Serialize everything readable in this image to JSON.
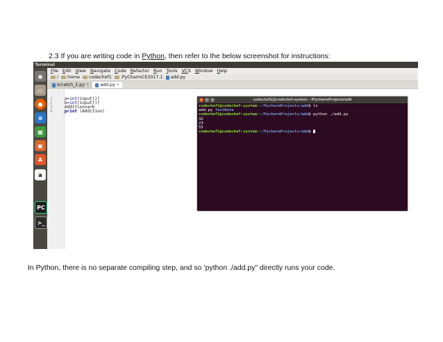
{
  "intro": {
    "prefix": "2.3 If you are writing code in ",
    "link": "Python",
    "suffix": ", then refer to the below screenshot for instructions:"
  },
  "outro": "In Python, there is no separate compiling step, and so ‘python ./add.py” directly runs your code.",
  "screenshot": {
    "topbar_title": "Terminal",
    "menu": [
      {
        "key": "F",
        "rest": "ile"
      },
      {
        "key": "E",
        "rest": "dit"
      },
      {
        "key": "V",
        "rest": "iew"
      },
      {
        "key": "N",
        "rest": "avigate"
      },
      {
        "key": "C",
        "rest": "ode"
      },
      {
        "key": "R",
        "rest": "efactor"
      },
      {
        "key": "R",
        "rest": "un"
      },
      {
        "key": "T",
        "rest": "ools"
      },
      {
        "key": "VC",
        "rest": "S"
      },
      {
        "key": "W",
        "rest": "indow"
      },
      {
        "key": "H",
        "rest": "elp"
      }
    ],
    "breadcrumbs": [
      "/",
      "home",
      "codechef1",
      ".PyCharmCE2017.1",
      "add.py"
    ],
    "tabs": [
      {
        "label": "scratch_1.py",
        "active": false
      },
      {
        "label": "add.py",
        "active": true
      }
    ],
    "editor": {
      "line_numbers": [
        "1",
        "2",
        "3",
        "4"
      ],
      "lines": [
        {
          "pre": "a=",
          "fn": "int",
          "post": "(input())"
        },
        {
          "pre": "b=",
          "fn": "int",
          "post": "(input())"
        },
        {
          "pre": "Addition=a+b",
          "fn": "",
          "post": ""
        },
        {
          "pre": "",
          "kw": "print",
          "post": " (Addition)"
        }
      ]
    },
    "launcher_icons": [
      "ubuntu-dash-icon",
      "files-icon",
      "firefox-icon",
      "writer-icon",
      "calc-icon",
      "impress-icon",
      "software-center-icon",
      "amazon-icon",
      "pycharm-icon",
      "terminal-icon"
    ],
    "terminal": {
      "title": "codechef1@codechef-system: ~/PycharmProjects/add",
      "lines": [
        {
          "user": "codechef1@codechef-system",
          "path": ":~/PycharmProjects/add",
          "cmd": "$ ls"
        },
        {
          "text": "add.py  ",
          "dir": "TestData"
        },
        {
          "user": "codechef1@codechef-system",
          "path": ":~/PycharmProjects/add",
          "cmd": "$ python ./add.py"
        },
        {
          "text": "32"
        },
        {
          "text": "23"
        },
        {
          "text": "55"
        },
        {
          "user": "codechef1@codechef-system",
          "path": ":~/PycharmProjects/add",
          "cmd": "$ "
        }
      ]
    }
  }
}
